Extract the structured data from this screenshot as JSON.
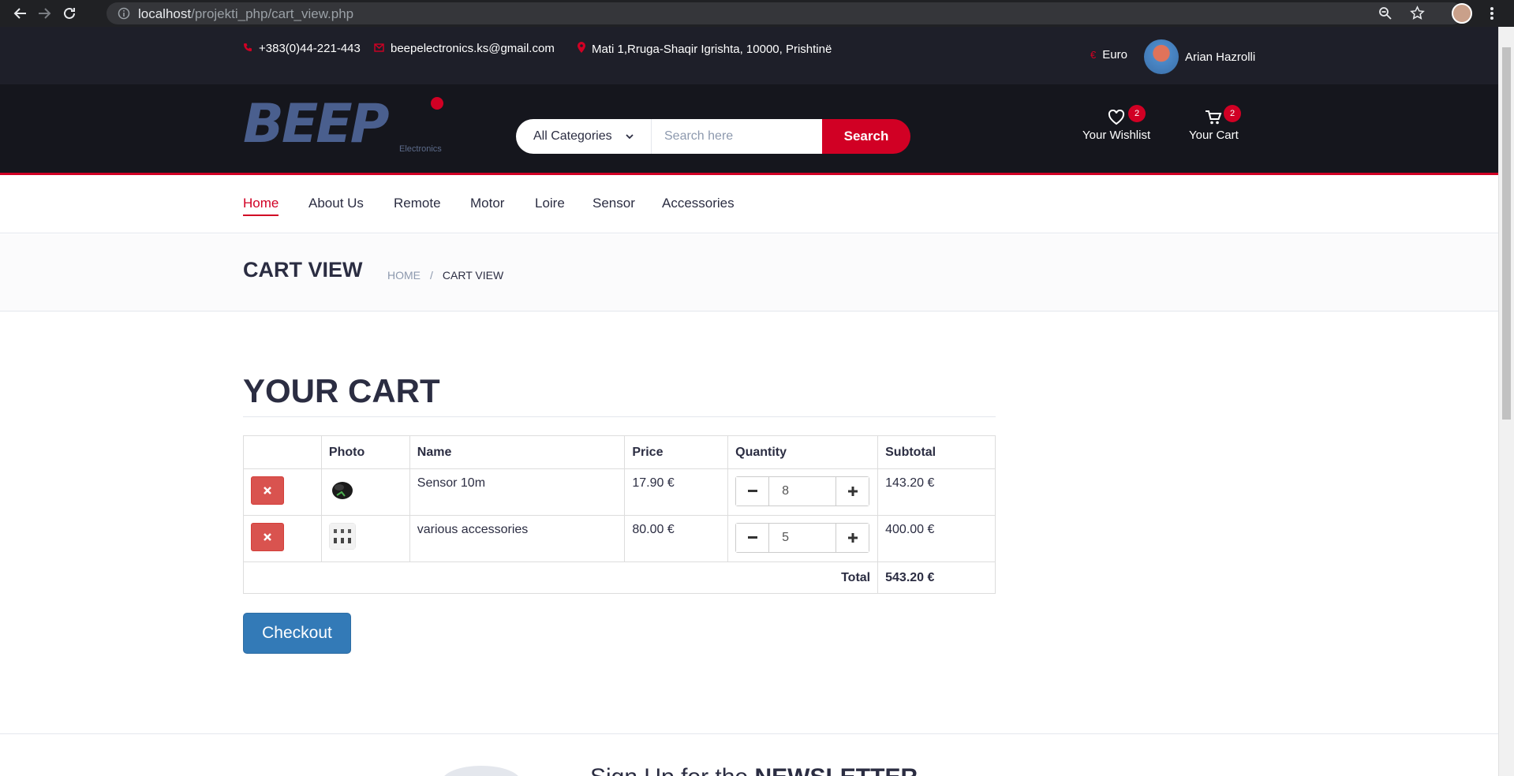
{
  "browser": {
    "url_host": "localhost",
    "url_path": "/projekti_php/cart_view.php"
  },
  "top_header": {
    "phone": "+383(0)44-221-443",
    "email": "beepelectronics.ks@gmail.com",
    "address": "Mati 1,Rruga-Shaqir Igrishta, 10000, Prishtinë",
    "currency": "Euro",
    "user_name": "Arian Hazrolli"
  },
  "logo": {
    "text": "BEEP",
    "subtext": "Electronics"
  },
  "search": {
    "category": "All Categories",
    "placeholder": "Search here",
    "button": "Search"
  },
  "header_actions": {
    "wishlist_label": "Your Wishlist",
    "wishlist_count": "2",
    "cart_label": "Your Cart",
    "cart_count": "2"
  },
  "navigation": {
    "items": [
      "Home",
      "About Us",
      "Remote",
      "Motor",
      "Loire",
      "Sensor",
      "Accessories"
    ]
  },
  "breadcrumb": {
    "title": "CART VIEW",
    "home": "HOME",
    "separator": "/",
    "current": "CART VIEW"
  },
  "cart": {
    "title": "YOUR CART",
    "headers": [
      "",
      "Photo",
      "Name",
      "Price",
      "Quantity",
      "Subtotal"
    ],
    "rows": [
      {
        "name": "Sensor 10m",
        "price": "17.90 €",
        "quantity": "8",
        "subtotal": "143.20 €"
      },
      {
        "name": "various accessories",
        "price": "80.00 €",
        "quantity": "5",
        "subtotal": "400.00 €"
      }
    ],
    "total_label": "Total",
    "total_value": "543.20 €",
    "checkout": "Checkout"
  },
  "newsletter": {
    "text_prefix": "Sign Up for the ",
    "text_bold": "NEWSLETTER"
  },
  "colors": {
    "brand_red": "#d10024",
    "header_dark": "#15161d",
    "top_dark": "#1e1f29",
    "checkout_blue": "#337ab7",
    "delete_red": "#d9534f"
  }
}
